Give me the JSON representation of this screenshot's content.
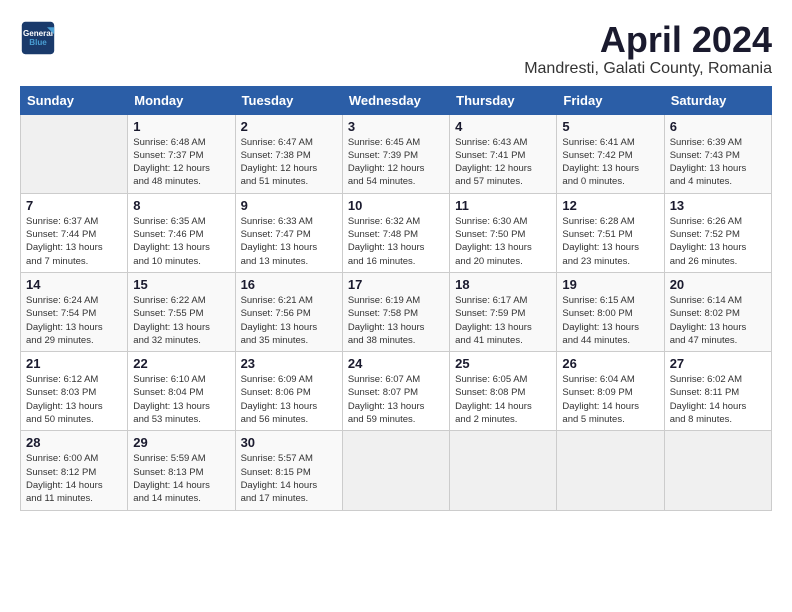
{
  "header": {
    "logo_line1": "General",
    "logo_line2": "Blue",
    "title": "April 2024",
    "subtitle": "Mandresti, Galati County, Romania"
  },
  "weekdays": [
    "Sunday",
    "Monday",
    "Tuesday",
    "Wednesday",
    "Thursday",
    "Friday",
    "Saturday"
  ],
  "weeks": [
    [
      {
        "day": "",
        "info": ""
      },
      {
        "day": "1",
        "info": "Sunrise: 6:48 AM\nSunset: 7:37 PM\nDaylight: 12 hours\nand 48 minutes."
      },
      {
        "day": "2",
        "info": "Sunrise: 6:47 AM\nSunset: 7:38 PM\nDaylight: 12 hours\nand 51 minutes."
      },
      {
        "day": "3",
        "info": "Sunrise: 6:45 AM\nSunset: 7:39 PM\nDaylight: 12 hours\nand 54 minutes."
      },
      {
        "day": "4",
        "info": "Sunrise: 6:43 AM\nSunset: 7:41 PM\nDaylight: 12 hours\nand 57 minutes."
      },
      {
        "day": "5",
        "info": "Sunrise: 6:41 AM\nSunset: 7:42 PM\nDaylight: 13 hours\nand 0 minutes."
      },
      {
        "day": "6",
        "info": "Sunrise: 6:39 AM\nSunset: 7:43 PM\nDaylight: 13 hours\nand 4 minutes."
      }
    ],
    [
      {
        "day": "7",
        "info": "Sunrise: 6:37 AM\nSunset: 7:44 PM\nDaylight: 13 hours\nand 7 minutes."
      },
      {
        "day": "8",
        "info": "Sunrise: 6:35 AM\nSunset: 7:46 PM\nDaylight: 13 hours\nand 10 minutes."
      },
      {
        "day": "9",
        "info": "Sunrise: 6:33 AM\nSunset: 7:47 PM\nDaylight: 13 hours\nand 13 minutes."
      },
      {
        "day": "10",
        "info": "Sunrise: 6:32 AM\nSunset: 7:48 PM\nDaylight: 13 hours\nand 16 minutes."
      },
      {
        "day": "11",
        "info": "Sunrise: 6:30 AM\nSunset: 7:50 PM\nDaylight: 13 hours\nand 20 minutes."
      },
      {
        "day": "12",
        "info": "Sunrise: 6:28 AM\nSunset: 7:51 PM\nDaylight: 13 hours\nand 23 minutes."
      },
      {
        "day": "13",
        "info": "Sunrise: 6:26 AM\nSunset: 7:52 PM\nDaylight: 13 hours\nand 26 minutes."
      }
    ],
    [
      {
        "day": "14",
        "info": "Sunrise: 6:24 AM\nSunset: 7:54 PM\nDaylight: 13 hours\nand 29 minutes."
      },
      {
        "day": "15",
        "info": "Sunrise: 6:22 AM\nSunset: 7:55 PM\nDaylight: 13 hours\nand 32 minutes."
      },
      {
        "day": "16",
        "info": "Sunrise: 6:21 AM\nSunset: 7:56 PM\nDaylight: 13 hours\nand 35 minutes."
      },
      {
        "day": "17",
        "info": "Sunrise: 6:19 AM\nSunset: 7:58 PM\nDaylight: 13 hours\nand 38 minutes."
      },
      {
        "day": "18",
        "info": "Sunrise: 6:17 AM\nSunset: 7:59 PM\nDaylight: 13 hours\nand 41 minutes."
      },
      {
        "day": "19",
        "info": "Sunrise: 6:15 AM\nSunset: 8:00 PM\nDaylight: 13 hours\nand 44 minutes."
      },
      {
        "day": "20",
        "info": "Sunrise: 6:14 AM\nSunset: 8:02 PM\nDaylight: 13 hours\nand 47 minutes."
      }
    ],
    [
      {
        "day": "21",
        "info": "Sunrise: 6:12 AM\nSunset: 8:03 PM\nDaylight: 13 hours\nand 50 minutes."
      },
      {
        "day": "22",
        "info": "Sunrise: 6:10 AM\nSunset: 8:04 PM\nDaylight: 13 hours\nand 53 minutes."
      },
      {
        "day": "23",
        "info": "Sunrise: 6:09 AM\nSunset: 8:06 PM\nDaylight: 13 hours\nand 56 minutes."
      },
      {
        "day": "24",
        "info": "Sunrise: 6:07 AM\nSunset: 8:07 PM\nDaylight: 13 hours\nand 59 minutes."
      },
      {
        "day": "25",
        "info": "Sunrise: 6:05 AM\nSunset: 8:08 PM\nDaylight: 14 hours\nand 2 minutes."
      },
      {
        "day": "26",
        "info": "Sunrise: 6:04 AM\nSunset: 8:09 PM\nDaylight: 14 hours\nand 5 minutes."
      },
      {
        "day": "27",
        "info": "Sunrise: 6:02 AM\nSunset: 8:11 PM\nDaylight: 14 hours\nand 8 minutes."
      }
    ],
    [
      {
        "day": "28",
        "info": "Sunrise: 6:00 AM\nSunset: 8:12 PM\nDaylight: 14 hours\nand 11 minutes."
      },
      {
        "day": "29",
        "info": "Sunrise: 5:59 AM\nSunset: 8:13 PM\nDaylight: 14 hours\nand 14 minutes."
      },
      {
        "day": "30",
        "info": "Sunrise: 5:57 AM\nSunset: 8:15 PM\nDaylight: 14 hours\nand 17 minutes."
      },
      {
        "day": "",
        "info": ""
      },
      {
        "day": "",
        "info": ""
      },
      {
        "day": "",
        "info": ""
      },
      {
        "day": "",
        "info": ""
      }
    ]
  ]
}
